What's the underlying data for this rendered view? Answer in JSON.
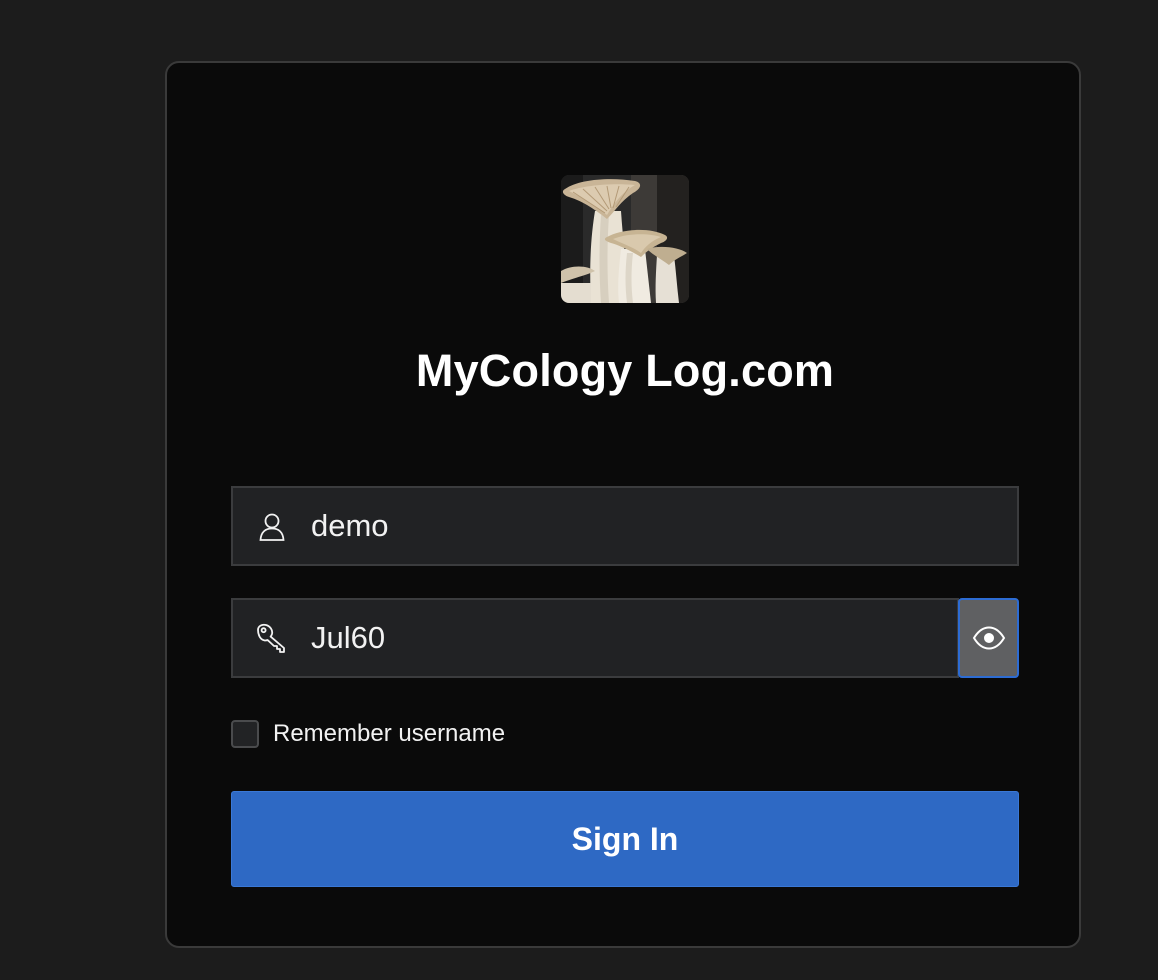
{
  "app": {
    "title": "MyCology Log.com",
    "logo": "oyster-mushroom-photo"
  },
  "login": {
    "username_value": "demo",
    "password_value": "Jul60",
    "user_icon": "user-icon",
    "key_icon": "key-icon",
    "reveal_icon": "eye-icon",
    "remember_label": "Remember username",
    "remember_checked": false,
    "signin_label": "Sign In"
  },
  "colors": {
    "background": "#1c1c1c",
    "card": "#0a0a0a",
    "field": "#212224",
    "accent": "#2e69c4",
    "reveal_button": "#5f6062"
  }
}
